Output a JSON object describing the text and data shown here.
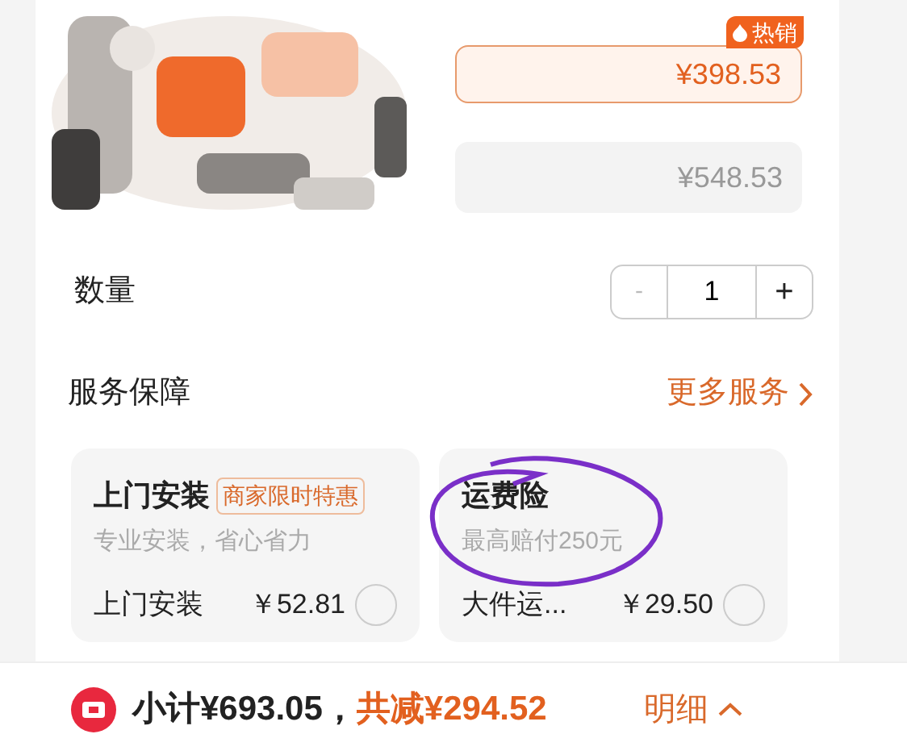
{
  "price_options": [
    {
      "price": "¥398.53",
      "badge": "热销",
      "selected": true
    },
    {
      "price": "¥548.53",
      "selected": false
    }
  ],
  "quantity": {
    "label": "数量",
    "minus": "-",
    "value": "1",
    "plus": "+"
  },
  "services": {
    "title": "服务保障",
    "more": "更多服务",
    "cards": [
      {
        "title": "上门安装",
        "tag": "商家限时特惠",
        "description": "专业安装，省心省力",
        "item": "上门安装",
        "price": "￥52.81",
        "checked": false,
        "circled": false
      },
      {
        "title": "运费险",
        "description": "最高赔付250元",
        "item": "大件运...",
        "price": "￥29.50",
        "checked": false,
        "circled": true
      }
    ]
  },
  "footer": {
    "subtotal": "小计¥693.05，",
    "discount": "共减¥294.52",
    "details": "明细"
  }
}
